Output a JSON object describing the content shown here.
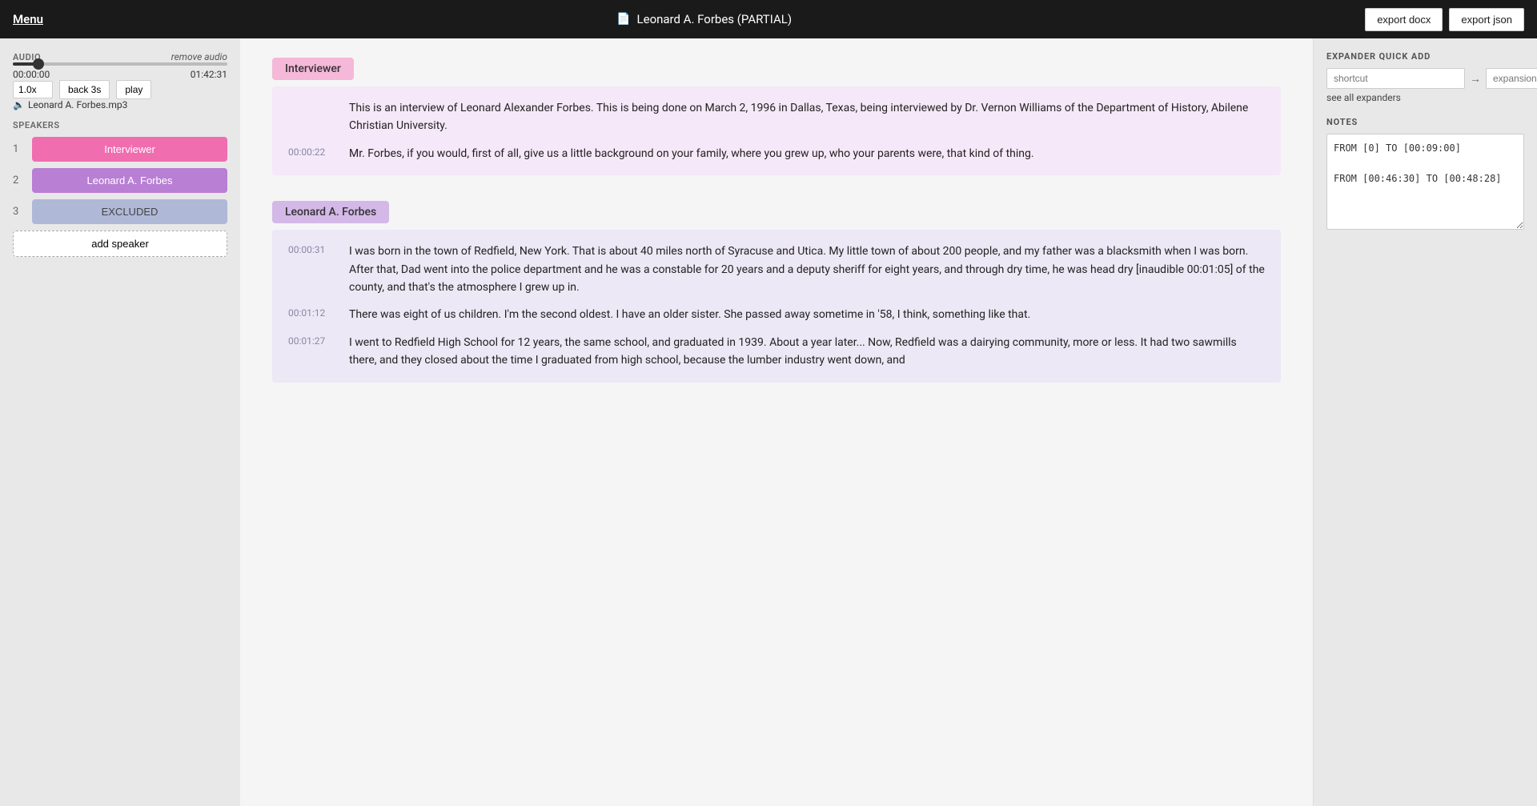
{
  "header": {
    "menu_label": "Menu",
    "title": "Leonard A. Forbes (PARTIAL)",
    "title_icon": "📄",
    "export_docx_label": "export docx",
    "export_json_label": "export json"
  },
  "audio": {
    "section_title": "AUDIO",
    "remove_audio_label": "remove audio",
    "current_time": "00:00:00",
    "total_time": "01:42:31",
    "speed": "1.0x",
    "back_label": "back 3s",
    "play_label": "play",
    "filename": "Leonard A. Forbes.mp3",
    "progress_percent": 10
  },
  "speakers": {
    "section_title": "SPEAKERS",
    "list": [
      {
        "number": "1",
        "label": "Interviewer",
        "style": "interviewer"
      },
      {
        "number": "2",
        "label": "Leonard A. Forbes",
        "style": "forbes"
      },
      {
        "number": "3",
        "label": "EXCLUDED",
        "style": "excluded"
      }
    ],
    "add_speaker_label": "add speaker"
  },
  "transcript": {
    "blocks": [
      {
        "speaker": "Interviewer",
        "speaker_style": "interviewer",
        "segments": [
          {
            "timestamp": "",
            "text": "This is an interview of Leonard Alexander Forbes. This is being done on March 2, 1996 in Dallas, Texas, being interviewed by Dr. Vernon Williams of the Department of History, Abilene Christian University."
          },
          {
            "timestamp": "00:00:22",
            "text": "Mr. Forbes, if you would, first of all, give us a little background on your family, where you grew up, who your parents were, that kind of thing."
          }
        ]
      },
      {
        "speaker": "Leonard A. Forbes",
        "speaker_style": "forbes",
        "segments": [
          {
            "timestamp": "00:00:31",
            "text": "I was born in the town of Redfield, New York. That is about 40 miles north of Syracuse and Utica. My little town of about 200 people, and my father was a blacksmith when I was born. After that, Dad went into the police department and he was a constable for 20 years and a deputy sheriff for eight years, and through dry time, he was head dry [inaudible 00:01:05] of the county, and that's the atmosphere I grew up in."
          },
          {
            "timestamp": "00:01:12",
            "text": "There was eight of us children. I'm the second oldest. I have an older sister. She passed away sometime in '58, I think, something like that."
          },
          {
            "timestamp": "00:01:27",
            "text": "I went to Redfield High School for 12 years, the same school, and graduated in 1939. About a year later... Now, Redfield was a dairying community, more or less. It had two sawmills there, and they closed about the time I graduated from high school, because the lumber industry went down, and"
          }
        ]
      }
    ]
  },
  "expander": {
    "section_title": "EXPANDER QUICK ADD",
    "shortcut_placeholder": "shortcut",
    "expansion_placeholder": "expansion",
    "see_all_label": "see all expanders",
    "add_icon": "+"
  },
  "notes": {
    "section_title": "NOTES",
    "content": "FROM [0] TO [00:09:00]\n\nFROM [00:46:30] TO [00:48:28]"
  }
}
